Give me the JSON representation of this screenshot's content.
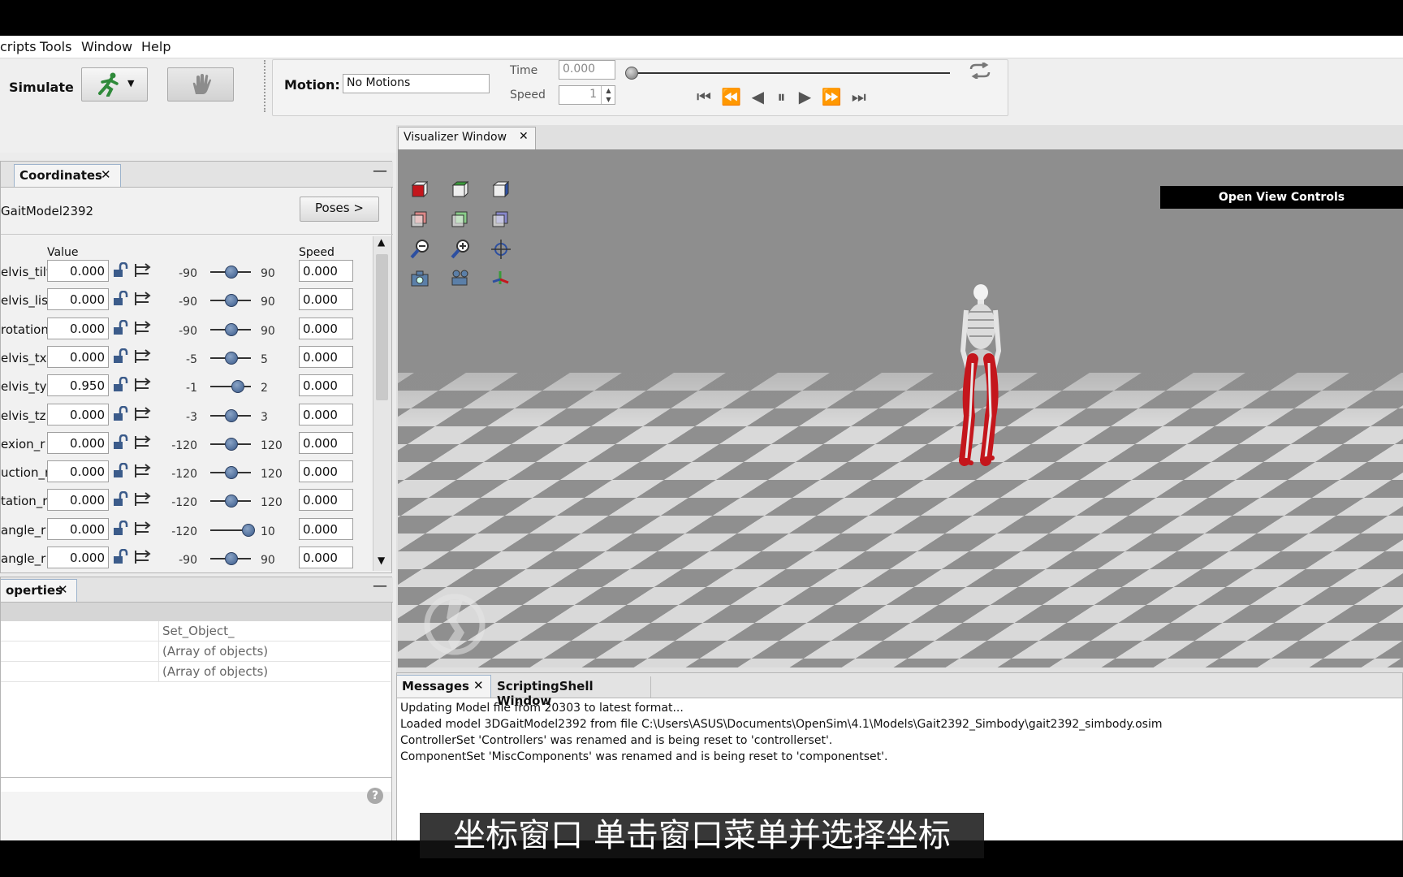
{
  "menu": [
    "cripts",
    "Tools",
    "Window",
    "Help"
  ],
  "toolbar": {
    "simulate_label": "Simulate",
    "motion_label": "Motion:",
    "motion_value": "No Motions",
    "time_label": "Time",
    "time_value": "0.000",
    "speed_label": "Speed",
    "speed_value": "1"
  },
  "coordinates": {
    "tab_label": "Coordinates",
    "model_name": "GaitModel2392",
    "poses_label": "Poses >",
    "value_header": "Value",
    "speed_header": "Speed",
    "rows": [
      {
        "name": "elvis_tilt",
        "value": "0.000",
        "min": "-90",
        "max": "90",
        "speed": "0.000",
        "pos": 0.5
      },
      {
        "name": "elvis_list",
        "value": "0.000",
        "min": "-90",
        "max": "90",
        "speed": "0.000",
        "pos": 0.5
      },
      {
        "name": "rotation",
        "value": "0.000",
        "min": "-90",
        "max": "90",
        "speed": "0.000",
        "pos": 0.5
      },
      {
        "name": "elvis_tx",
        "value": "0.000",
        "min": "-5",
        "max": "5",
        "speed": "0.000",
        "pos": 0.5
      },
      {
        "name": "elvis_ty",
        "value": "0.950",
        "min": "-1",
        "max": "2",
        "speed": "0.000",
        "pos": 0.65
      },
      {
        "name": "elvis_tz",
        "value": "0.000",
        "min": "-3",
        "max": "3",
        "speed": "0.000",
        "pos": 0.5
      },
      {
        "name": "exion_r",
        "value": "0.000",
        "min": "-120",
        "max": "120",
        "speed": "0.000",
        "pos": 0.5
      },
      {
        "name": "uction_r",
        "value": "0.000",
        "min": "-120",
        "max": "120",
        "speed": "0.000",
        "pos": 0.5
      },
      {
        "name": "tation_r",
        "value": "0.000",
        "min": "-120",
        "max": "120",
        "speed": "0.000",
        "pos": 0.5
      },
      {
        "name": "angle_r",
        "value": "0.000",
        "min": "-120",
        "max": "10",
        "speed": "0.000",
        "pos": 0.92
      },
      {
        "name": "angle_r",
        "value": "0.000",
        "min": "-90",
        "max": "90",
        "speed": "0.000",
        "pos": 0.5
      }
    ]
  },
  "properties": {
    "tab_label": "operties",
    "rows": [
      "Set_Object_",
      "(Array of objects)",
      "(Array of objects)"
    ],
    "help_glyph": "?"
  },
  "visualizer": {
    "tab_label": "Visualizer Window",
    "open_controls": "Open View Controls"
  },
  "messages": {
    "tab_label": "Messages",
    "tab2_label": "ScriptingShell Window",
    "lines": [
      "Updating Model file from 20303 to latest format...",
      "Loaded model 3DGaitModel2392 from file C:\\Users\\ASUS\\Documents\\OpenSim\\4.1\\Models\\Gait2392_Simbody\\gait2392_simbody.osim",
      "ControllerSet 'Controllers' was renamed and is being reset to 'controllerset'.",
      "ComponentSet 'MiscComponents' was renamed and is being reset to 'componentset'."
    ]
  },
  "subtitle": "坐标窗口 单击窗口菜单并选择坐标",
  "colors": {
    "accent": "#2f8a3a",
    "muscle": "#c4161c",
    "viewport_bg": "#8e8e8e"
  }
}
